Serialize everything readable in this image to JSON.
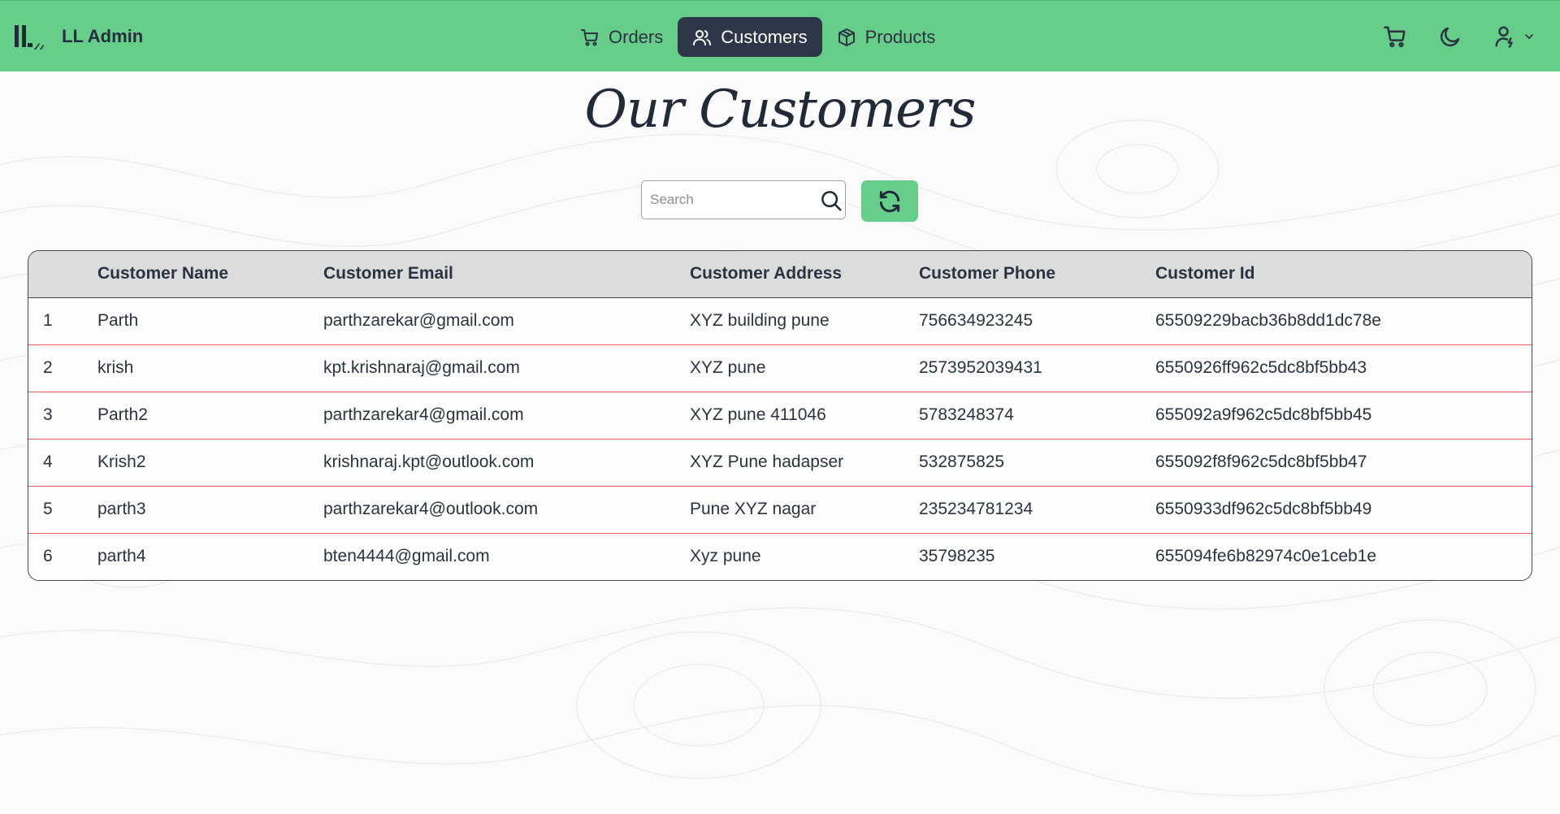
{
  "colors": {
    "topbar": "#66cd8a",
    "active_nav": "#2e3747",
    "row_divider": "#e35b5b",
    "header_row": "#dcdcdc"
  },
  "brand": {
    "name": "LL Admin",
    "logo_icon": "ll-logo-icon"
  },
  "nav": {
    "orders": {
      "label": "Orders",
      "icon": "cart-icon"
    },
    "customers": {
      "label": "Customers",
      "icon": "users-icon",
      "active": true
    },
    "products": {
      "label": "Products",
      "icon": "box-icon"
    }
  },
  "top_actions": [
    "cart-icon",
    "moon-icon",
    "user-menu-icon",
    "chevron-down-icon"
  ],
  "page": {
    "title": "Our Customers"
  },
  "search": {
    "placeholder": "Search",
    "value": ""
  },
  "refresh": {
    "icon": "refresh-icon"
  },
  "table": {
    "headers": [
      "",
      "Customer Name",
      "Customer Email",
      "Customer Address",
      "Customer Phone",
      "Customer Id"
    ],
    "rows": [
      [
        "1",
        "Parth",
        "parthzarekar@gmail.com",
        "XYZ building pune",
        "756634923245",
        "65509229bacb36b8dd1dc78e"
      ],
      [
        "2",
        "krish",
        "kpt.krishnaraj@gmail.com",
        "XYZ pune",
        "2573952039431",
        "6550926ff962c5dc8bf5bb43"
      ],
      [
        "3",
        "Parth2",
        "parthzarekar4@gmail.com",
        "XYZ pune 411046",
        "5783248374",
        "655092a9f962c5dc8bf5bb45"
      ],
      [
        "4",
        "Krish2",
        "krishnaraj.kpt@outlook.com",
        "XYZ Pune hadapser",
        "532875825",
        "655092f8f962c5dc8bf5bb47"
      ],
      [
        "5",
        "parth3",
        "parthzarekar4@outlook.com",
        "Pune XYZ nagar",
        "235234781234",
        "6550933df962c5dc8bf5bb49"
      ],
      [
        "6",
        "parth4",
        "bten4444@gmail.com",
        "Xyz pune",
        "35798235",
        "655094fe6b82974c0e1ceb1e"
      ]
    ]
  }
}
